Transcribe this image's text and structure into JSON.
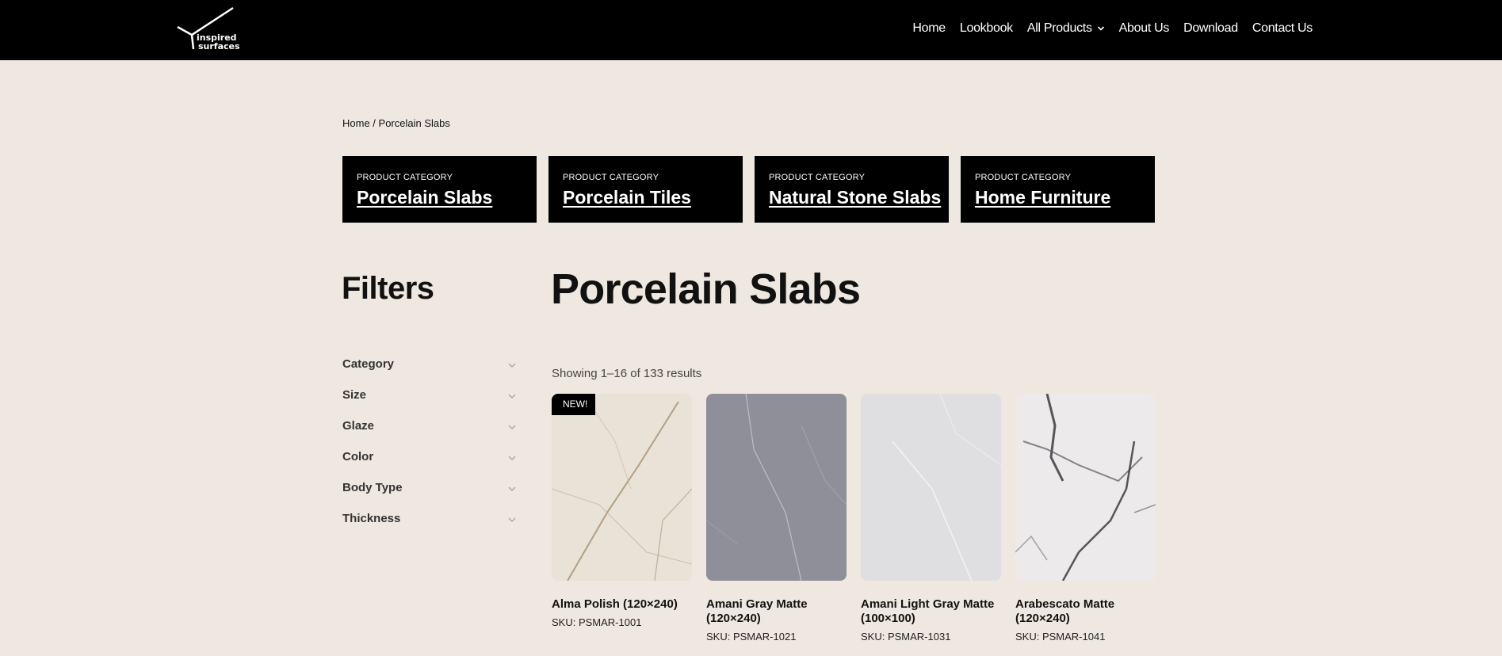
{
  "nav": {
    "logo_text": "inspired surfaces",
    "items": [
      "Home",
      "Lookbook",
      "All Products",
      "About Us",
      "Download",
      "Contact Us"
    ]
  },
  "breadcrumb": {
    "home": "Home",
    "separator": " / ",
    "current": "Porcelain Slabs"
  },
  "categories": [
    {
      "kicker": "PRODUCT CATEGORY",
      "title": "Porcelain Slabs"
    },
    {
      "kicker": "PRODUCT CATEGORY",
      "title": "Porcelain Tiles"
    },
    {
      "kicker": "PRODUCT CATEGORY",
      "title": "Natural Stone Slabs"
    },
    {
      "kicker": "PRODUCT CATEGORY",
      "title": "Home Furniture"
    }
  ],
  "filters": {
    "title": "Filters",
    "items": [
      "Category",
      "Size",
      "Glaze",
      "Color",
      "Body Type",
      "Thickness"
    ]
  },
  "main": {
    "title": "Porcelain Slabs",
    "results": "Showing 1–16 of 133 results"
  },
  "products": [
    {
      "badge": "NEW!",
      "name": "Alma Polish (120×240)",
      "sku": "SKU: PSMAR-1001",
      "swatch": "#e9e2d7"
    },
    {
      "badge": "",
      "name": "Amani Gray Matte (120×240)",
      "sku": "SKU: PSMAR-1021",
      "swatch": "#8e8f99"
    },
    {
      "badge": "",
      "name": "Amani Light Gray Matte (100×100)",
      "sku": "SKU: PSMAR-1031",
      "swatch": "#dfdee1"
    },
    {
      "badge": "",
      "name": "Arabescato Matte (120×240)",
      "sku": "SKU: PSMAR-1041",
      "swatch": "#eceaea"
    }
  ],
  "colors": {
    "header_bg": "#000000",
    "page_bg": "#efe8e0"
  }
}
